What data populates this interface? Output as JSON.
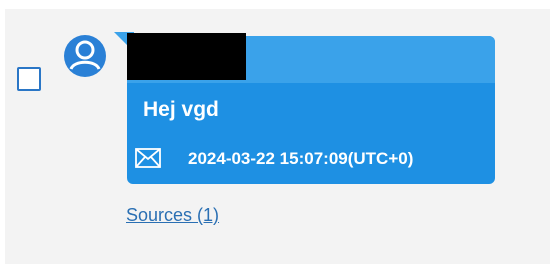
{
  "message": {
    "sender_name": "",
    "text": "Hej vgd",
    "delivery_icon": "envelope-icon",
    "timestamp": "2024-03-22 15:07:09(UTC+0)",
    "selected": false
  },
  "sources": {
    "label": "Sources (1)"
  },
  "colors": {
    "bubble": "#1e90e3",
    "bubble_header": "#3aa2ea",
    "avatar": "#2a80d6",
    "link": "#2a6fb3",
    "panel_background": "#f3f3f3"
  }
}
